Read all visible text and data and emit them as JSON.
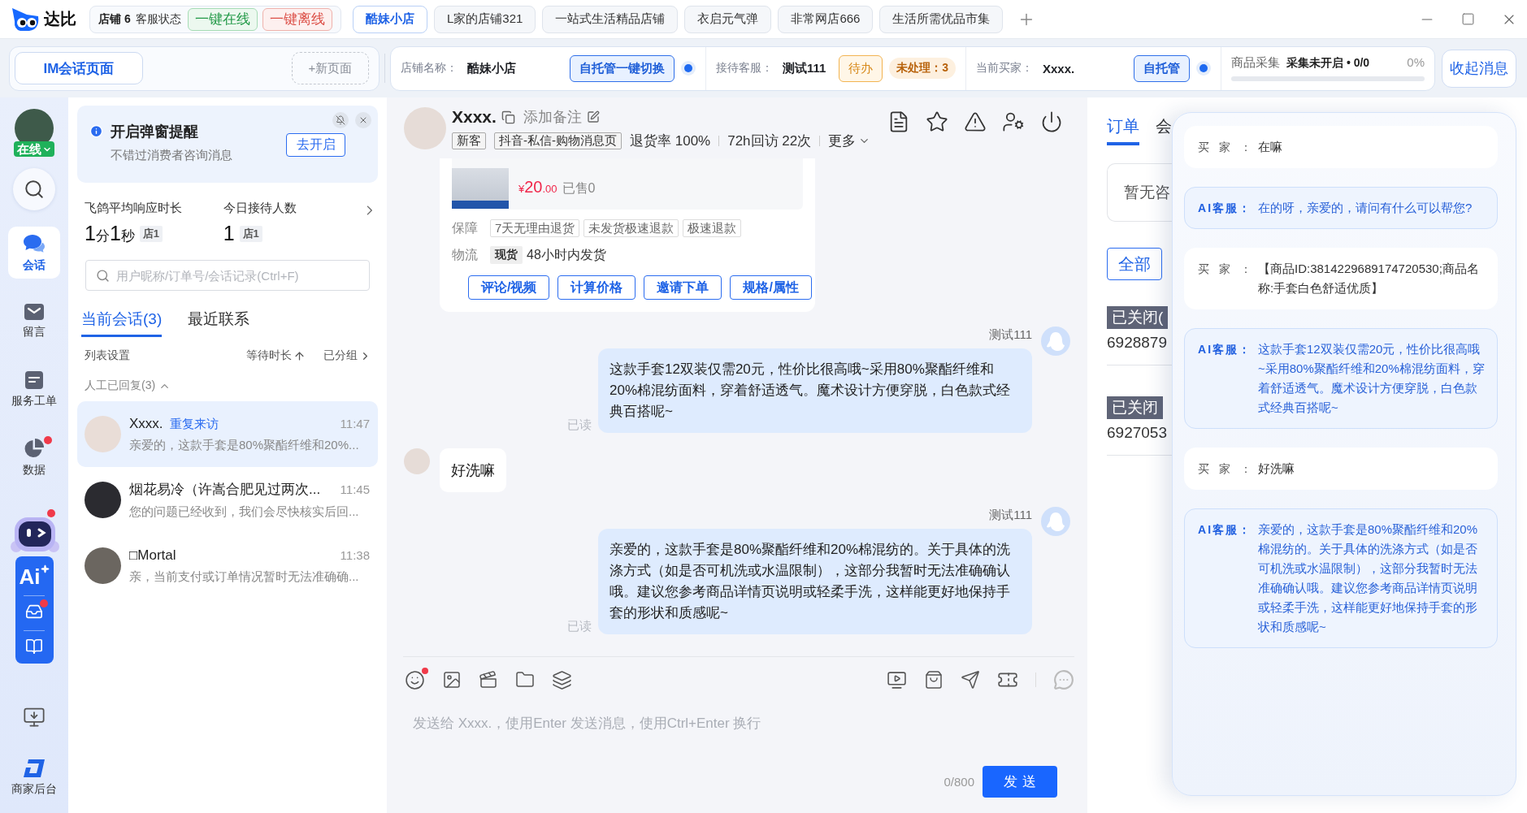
{
  "top_bar": {
    "logo": "达比",
    "store_count": "店铺 6",
    "status_label": "客服状态",
    "online_button": "一键在线",
    "offline_button": "一键离线",
    "store_tabs": [
      {
        "label": "酷妹小店",
        "selected": true
      },
      {
        "label": "L家的店铺321",
        "selected": false
      },
      {
        "label": "一站式生活精品店铺",
        "selected": false
      },
      {
        "label": "衣启元气弹",
        "selected": false
      },
      {
        "label": "非常网店666",
        "selected": false
      },
      {
        "label": "生活所需优品市集",
        "selected": false
      }
    ]
  },
  "page_tabs": {
    "current": "IM会话页面",
    "new_page": "+新页面"
  },
  "session_bar": {
    "store_label": "店铺名称：",
    "store_name": "酷妹小店",
    "switch_button": "自托管一键切换",
    "agent_label": "接待客服：",
    "agent_name": "测试111",
    "todo_button": "待办",
    "pending": "未处理：3",
    "buyer_label": "当前买家：",
    "buyer_name": "Xxxx.",
    "hosting_button": "自托管",
    "collection": {
      "label": "商品采集",
      "status": "采集未开启 • 0/0",
      "percent": "0%",
      "level": 0
    },
    "collapse_button": "收起消息"
  },
  "nav": {
    "status": "在线",
    "items": [
      {
        "label": "会话",
        "selected": true,
        "unread": false
      },
      {
        "label": "留言",
        "selected": false,
        "unread": false
      },
      {
        "label": "服务工单",
        "selected": false,
        "unread": false
      },
      {
        "label": "数据",
        "selected": false,
        "unread": true
      }
    ],
    "ai_assistant": {
      "label": "Ai",
      "unread": true,
      "inbox_unread": true
    },
    "merchant_label": "商家后台"
  },
  "conversation_list": {
    "notice": {
      "title": "开启弹窗提醒",
      "subtitle": "不错过消费者咨询消息",
      "button": "去开启"
    },
    "stats": [
      {
        "label": "飞鸽平均响应时长",
        "value": [
          {
            "text": "1",
            "kind": "number"
          },
          {
            "text": "分",
            "kind": "unit"
          },
          {
            "text": "1",
            "kind": "number"
          },
          {
            "text": "秒",
            "kind": "unit"
          }
        ],
        "tag": "店1"
      },
      {
        "label": "今日接待人数",
        "value": [
          {
            "text": "1",
            "kind": "number"
          }
        ],
        "tag": "店1"
      }
    ],
    "search": {
      "placeholder": "用户昵称/订单号/会话记录(Ctrl+F)"
    },
    "tabs": [
      {
        "label": "当前会话(3)",
        "selected": true
      },
      {
        "label": "最近联系",
        "selected": false
      }
    ],
    "controls": {
      "settings": "列表设置",
      "sort": "等待时长",
      "grouping": "已分组"
    },
    "group": {
      "label": "人工已回复(3)",
      "expanded": true
    },
    "conversations": [
      {
        "name": "Xxxx.",
        "tag": "重复来访",
        "time": "11:47",
        "preview": "亲爱的，这款手套是80%聚酯纤维和20%...",
        "selected": true
      },
      {
        "name": "烟花易冷（许嵩合肥见过两次...",
        "time": "11:45",
        "preview": "您的问题已经收到，我们会尽快核实后回...",
        "selected": false
      },
      {
        "name": "□Mortal",
        "time": "11:38",
        "preview": "亲，当前支付或订单情况暂时无法准确确...",
        "selected": false
      }
    ]
  },
  "chat": {
    "header": {
      "name": "Xxxx.",
      "note_link": "添加备注",
      "tags": [
        "新客",
        "抖音-私信-购物消息页"
      ],
      "stats": [
        "退货率 100%",
        "72h回访 22次"
      ],
      "more": "更多"
    },
    "messages": [
      {
        "kind": "product",
        "price": {
          "currency": "¥",
          "integer": "20",
          "decimal": ".00"
        },
        "sold": "已售0",
        "guarantee_label": "保障",
        "guarantees": [
          "7天无理由退货",
          "未发货极速退款",
          "极速退款"
        ],
        "logistics_label": "物流",
        "stock_tag": "现货",
        "shipping": "48小时内发货",
        "actions": [
          "评论/视频",
          "计算价格",
          "邀请下单",
          "规格/属性"
        ]
      },
      {
        "kind": "outgoing",
        "sender": "测试111",
        "text": "这款手套12双装仅需20元，性价比很高哦~采用80%聚酯纤维和20%棉混纺面料，穿着舒适透气。魔术设计方便穿脱，白色款式经典百搭呢~",
        "read": "已读"
      },
      {
        "kind": "incoming",
        "text": "好洗嘛"
      },
      {
        "kind": "outgoing",
        "sender": "测试111",
        "text": "亲爱的，这款手套是80%聚酯纤维和20%棉混纺的。关于具体的洗涤方式（如是否可机洗或水温限制），这部分我暂时无法准确确认哦。建议您参考商品详情页说明或轻柔手洗，这样能更好地保持手套的形状和质感呢~",
        "read": "已读"
      }
    ],
    "composer": {
      "placeholder": "发送给 Xxxx.，使用Enter 发送消息，使用Ctrl+Enter 换行",
      "counter": "0/800",
      "send_button": "发送"
    }
  },
  "side_panel": {
    "tabs": [
      {
        "label": "订单",
        "selected": true
      },
      {
        "label": "会",
        "selected": false
      }
    ],
    "empty_text": "暂无咨",
    "filter_button": "全部",
    "orders": [
      {
        "status": "已关闭(",
        "number": "6928879"
      },
      {
        "status": "已关闭",
        "number": "6927053"
      }
    ]
  },
  "ai_log": {
    "entries": [
      {
        "kind": "buyer",
        "label": "买家：",
        "text": "在嘛"
      },
      {
        "kind": "ai",
        "label": "AI客服：",
        "text": "在的呀，亲爱的，请问有什么可以帮您?"
      },
      {
        "kind": "buyer",
        "label": "买家：",
        "text": "【商品ID:3814229689174720530;商品名称:手套白色舒适优质】"
      },
      {
        "kind": "ai",
        "label": "AI客服：",
        "text": "这款手套12双装仅需20元，性价比很高哦~采用80%聚酯纤维和20%棉混纺面料，穿着舒适透气。魔术设计方便穿脱，白色款式经典百搭呢~"
      },
      {
        "kind": "buyer",
        "label": "买家：",
        "text": "好洗嘛"
      },
      {
        "kind": "ai",
        "label": "AI客服：",
        "text": "亲爱的，这款手套是80%聚酯纤维和20%棉混纺的。关于具体的洗涤方式（如是否可机洗或水温限制），这部分我暂时无法准确确认哦。建议您参考商品详情页说明或轻柔手洗，这样能更好地保持手套的形状和质感呢~"
      }
    ]
  }
}
